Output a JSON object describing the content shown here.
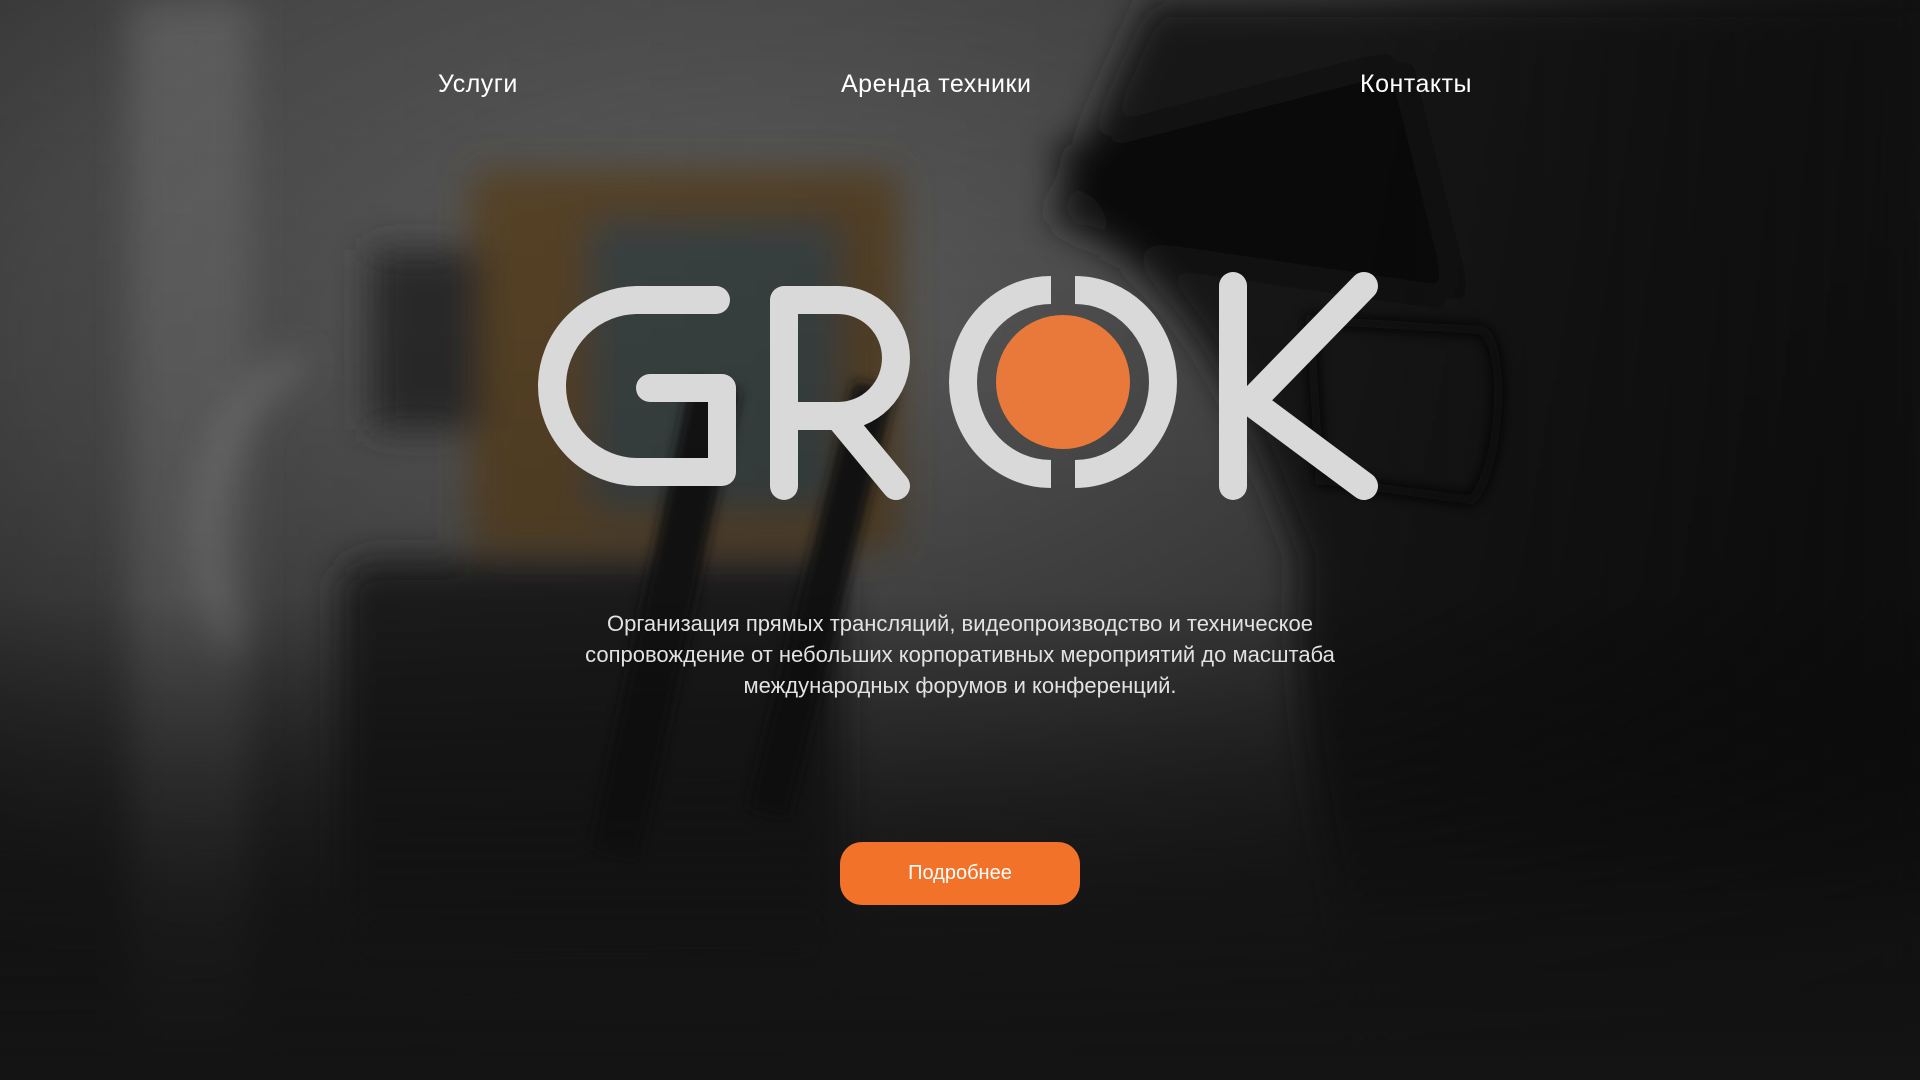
{
  "nav": {
    "services_label": "Услуги",
    "rental_label": "Аренда техники",
    "contacts_label": "Контакты"
  },
  "logo": {
    "text": "GROK",
    "letter_color": "#d9d9d9",
    "dot_color": "#e8793b"
  },
  "hero": {
    "tagline_line1": "Организация прямых трансляций, видеопроизводство и техническое",
    "tagline_line2": "сопровождение от небольших корпоративных мероприятий до масштаба",
    "tagline_line3": "международных форумов и конференций.",
    "cta_label": "Подробнее",
    "cta_color": "#f2722a",
    "background_image": "blurred-camera-operator-photo"
  }
}
